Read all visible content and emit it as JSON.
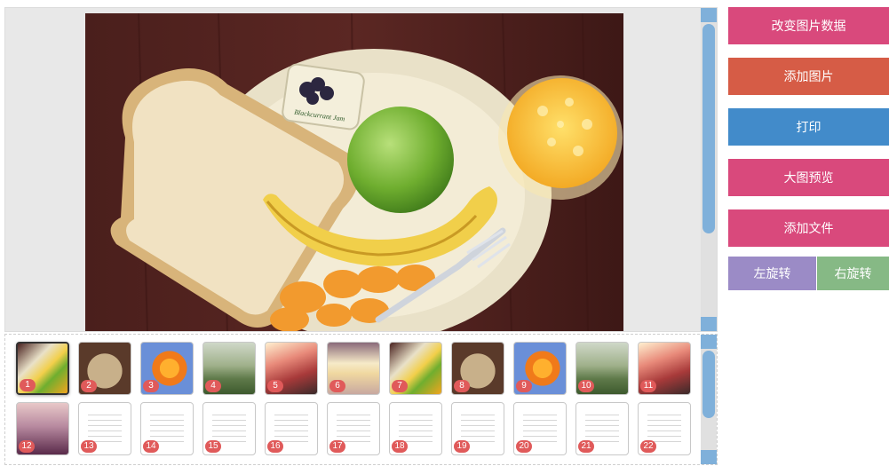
{
  "buttons": {
    "change_data": "改变图片数据",
    "add_image": "添加图片",
    "print": "打印",
    "preview": "大图预览",
    "add_file": "添加文件",
    "rotate_left": "左旋转",
    "rotate_right": "右旋转"
  },
  "colors": {
    "pink": "#d9497c",
    "orange": "#d65c46",
    "blue": "#428bca",
    "purple": "#9b8bc6",
    "green": "#86b985",
    "badge": "#e05a5a",
    "scroll": "#7fb0da"
  },
  "main_image": {
    "label_text": "Blackcurrant Jam"
  },
  "thumbnails": [
    {
      "num": "1",
      "kind": "breakfast",
      "selected": true
    },
    {
      "num": "2",
      "kind": "meal"
    },
    {
      "num": "3",
      "kind": "flower"
    },
    {
      "num": "4",
      "kind": "tree"
    },
    {
      "num": "5",
      "kind": "sunset-red"
    },
    {
      "num": "6",
      "kind": "blur-light"
    },
    {
      "num": "7",
      "kind": "breakfast"
    },
    {
      "num": "8",
      "kind": "meal"
    },
    {
      "num": "9",
      "kind": "flower"
    },
    {
      "num": "10",
      "kind": "tree"
    },
    {
      "num": "11",
      "kind": "sunset-red"
    },
    {
      "num": "12",
      "kind": "sunset-purple"
    },
    {
      "num": "13",
      "kind": "document"
    },
    {
      "num": "14",
      "kind": "document"
    },
    {
      "num": "15",
      "kind": "document"
    },
    {
      "num": "16",
      "kind": "document"
    },
    {
      "num": "17",
      "kind": "document"
    },
    {
      "num": "18",
      "kind": "document"
    },
    {
      "num": "19",
      "kind": "document"
    },
    {
      "num": "20",
      "kind": "document"
    },
    {
      "num": "21",
      "kind": "document"
    },
    {
      "num": "22",
      "kind": "document"
    }
  ]
}
